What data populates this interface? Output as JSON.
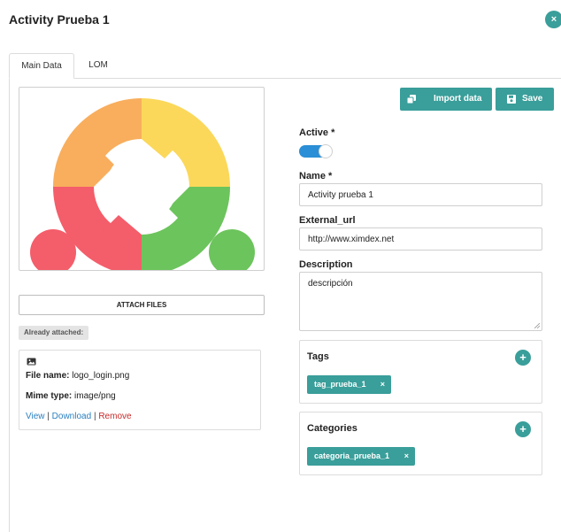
{
  "window": {
    "title": "Activity Prueba 1",
    "close_glyph": "×"
  },
  "tabs": [
    {
      "label": "Main Data",
      "active": true
    },
    {
      "label": "LOM",
      "active": false
    }
  ],
  "toolbar": {
    "import_label": "Import data",
    "save_label": "Save"
  },
  "attach": {
    "button_label": "ATTACH FILES",
    "attached_label": "Already attached:"
  },
  "file": {
    "name_label": "File name:",
    "name_value": "logo_login.png",
    "mime_label": "Mime type:",
    "mime_value": "image/png",
    "links": {
      "view": "View",
      "separator": "|",
      "download": "Download",
      "remove": "Remove"
    }
  },
  "form": {
    "active_label": "Active *",
    "active_value": true,
    "name_label": "Name *",
    "name_value": "Activity prueba 1",
    "url_label": "External_url",
    "url_value": "http://www.ximdex.net",
    "description_label": "Description",
    "description_value": "descripción"
  },
  "tags": {
    "title": "Tags",
    "plus": "+",
    "items": [
      {
        "label": "tag_prueba_1",
        "remove": "×"
      }
    ]
  },
  "categories": {
    "title": "Categories",
    "plus": "+",
    "items": [
      {
        "label": "categoria_prueba_1",
        "remove": "×"
      }
    ]
  },
  "colors": {
    "accent": "#3a9e9a",
    "toggle": "#2a8fd6",
    "link": "#2a7fc0",
    "remove": "#c62828",
    "logo_orange": "#f8ae5d",
    "logo_yellow": "#fbd85a",
    "logo_red": "#f45d6a",
    "logo_green": "#6cc45c"
  }
}
